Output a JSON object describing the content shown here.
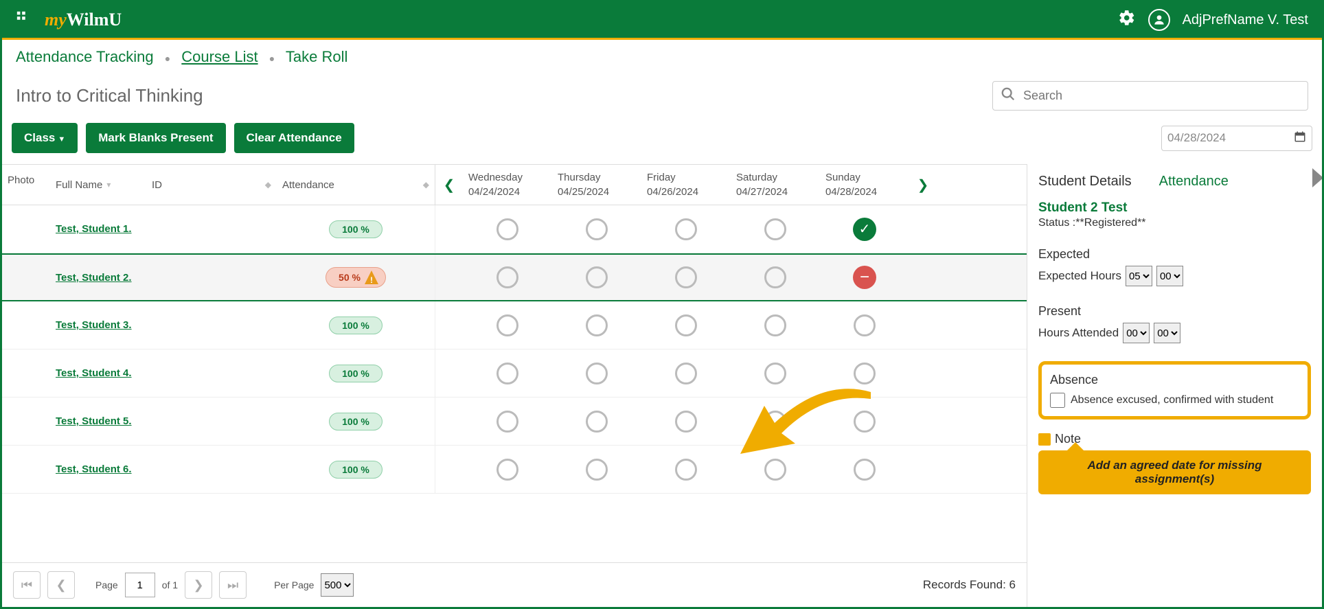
{
  "header": {
    "logo_my": "my",
    "logo_wilmu": "WilmU",
    "username": "AdjPrefName V. Test"
  },
  "breadcrumb": {
    "item1": "Attendance Tracking",
    "item2": "Course List",
    "item3": "Take Roll"
  },
  "page": {
    "title": "Intro to Critical Thinking",
    "search_placeholder": "Search"
  },
  "actions": {
    "class_btn": "Class",
    "mark_blanks": "Mark Blanks Present",
    "clear": "Clear Attendance",
    "date": "04/28/2024"
  },
  "columns": {
    "photo": "Photo",
    "full_name": "Full Name",
    "id": "ID",
    "attendance": "Attendance"
  },
  "days": [
    {
      "dow": "Wednesday",
      "date": "04/24/2024"
    },
    {
      "dow": "Thursday",
      "date": "04/25/2024"
    },
    {
      "dow": "Friday",
      "date": "04/26/2024"
    },
    {
      "dow": "Saturday",
      "date": "04/27/2024"
    },
    {
      "dow": "Sunday",
      "date": "04/28/2024"
    }
  ],
  "rows": [
    {
      "name": "Test, Student 1.",
      "att": "100 %",
      "pill": "green",
      "sunday": "check"
    },
    {
      "name": "Test, Student 2.",
      "att": "50 %",
      "pill": "red",
      "sunday": "minus",
      "selected": true
    },
    {
      "name": "Test, Student 3.",
      "att": "100 %",
      "pill": "green",
      "sunday": "empty"
    },
    {
      "name": "Test, Student 4.",
      "att": "100 %",
      "pill": "green",
      "sunday": "empty"
    },
    {
      "name": "Test, Student 5.",
      "att": "100 %",
      "pill": "green",
      "sunday": "empty"
    },
    {
      "name": "Test, Student 6.",
      "att": "100 %",
      "pill": "green",
      "sunday": "empty"
    }
  ],
  "pager": {
    "page_label": "Page",
    "page": "1",
    "of": "of 1",
    "perpage_label": "Per Page",
    "perpage": "500",
    "records": "Records Found: 6"
  },
  "side": {
    "tab1": "Student Details",
    "tab2": "Attendance",
    "student": "Student 2 Test",
    "status_label": "Status :",
    "status_value": "**Registered**",
    "expected": "Expected",
    "expected_hours_label": "Expected Hours",
    "expected_h": "05",
    "expected_m": "00",
    "present": "Present",
    "hours_attended_label": "Hours Attended",
    "present_h": "00",
    "present_m": "00",
    "absence": "Absence",
    "absence_checkbox": "Absence excused, confirmed with student",
    "note": "Note",
    "callout": "Add an agreed date for missing assignment(s)"
  }
}
